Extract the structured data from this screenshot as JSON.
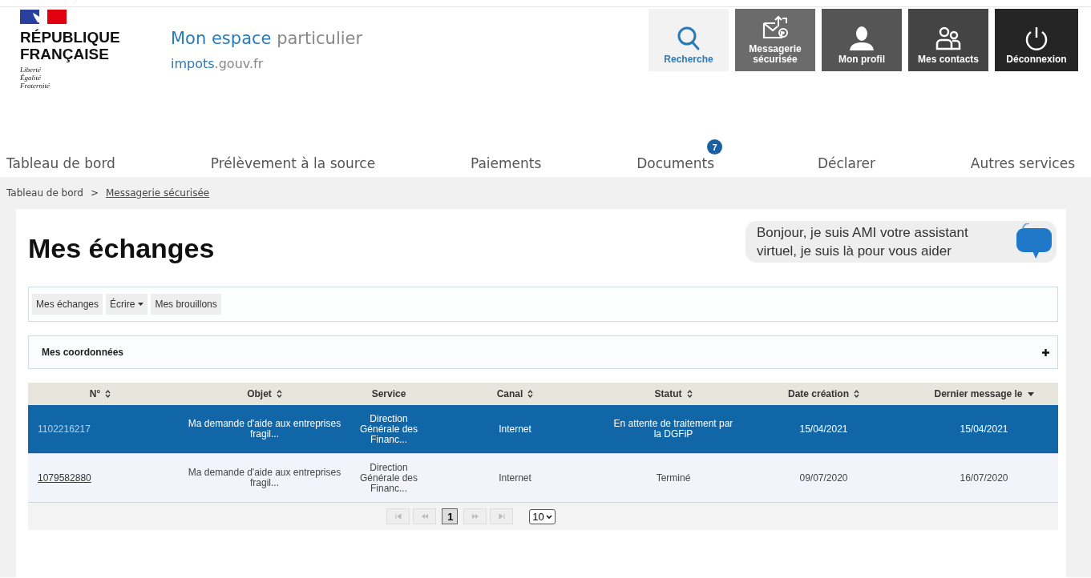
{
  "brand": {
    "republic": "RÉPUBLIQUE FRANÇAISE",
    "motto": [
      "Liberté",
      "Égalité",
      "Fraternité"
    ],
    "title": [
      {
        "text": "Mon espace",
        "kind": "accent"
      },
      {
        "text": " particulier",
        "kind": "plain"
      }
    ],
    "site": [
      {
        "text": "impots",
        "kind": "accent"
      },
      {
        "text": ".gouv.fr",
        "kind": "plain"
      }
    ]
  },
  "top_actions": [
    {
      "label": "Recherche",
      "kind": "search"
    },
    {
      "label": "Messagerie sécurisée",
      "kind": "messaging"
    },
    {
      "label": "Mon profil",
      "kind": "profile"
    },
    {
      "label": "Mes contacts",
      "kind": "contacts"
    },
    {
      "label": "Déconnexion",
      "kind": "logout"
    }
  ],
  "nav": [
    {
      "label": "Tableau de bord"
    },
    {
      "label": "Prélèvement à la source"
    },
    {
      "label": "Paiements"
    },
    {
      "label": "Documents",
      "badge": "7"
    },
    {
      "label": "Déclarer"
    },
    {
      "label": "Autres services"
    }
  ],
  "breadcrumb": {
    "items": [
      "Tableau de bord",
      "Messagerie sécurisée"
    ],
    "separator": ">"
  },
  "page_title": "Mes échanges",
  "assistant": {
    "message": "Bonjour, je suis AMI votre assistant virtuel, je suis là pour vous aider"
  },
  "toolbar": [
    {
      "label": "Mes échanges",
      "dropdown": false
    },
    {
      "label": "Écrire",
      "dropdown": true
    },
    {
      "label": "Mes brouillons",
      "dropdown": false
    }
  ],
  "accordion": {
    "title": "Mes coordonnées",
    "expanded": false
  },
  "table": {
    "columns": [
      {
        "label": "N°",
        "sortable": true,
        "sorted": false
      },
      {
        "label": "Objet",
        "sortable": true,
        "sorted": false
      },
      {
        "label": "Service",
        "sortable": false,
        "sorted": false
      },
      {
        "label": "Canal",
        "sortable": true,
        "sorted": false
      },
      {
        "label": "Statut",
        "sortable": true,
        "sorted": false
      },
      {
        "label": "Date création",
        "sortable": true,
        "sorted": false
      },
      {
        "label": "Dernier message le",
        "sortable": true,
        "sorted": true
      }
    ],
    "rows": [
      {
        "selected": true,
        "cells": [
          "1102216217",
          "Ma demande d'aide aux entreprises fragil...",
          "Direction Générale des Financ...",
          "Internet",
          "En attente de traitement par la DGFiP",
          "15/04/2021",
          "15/04/2021"
        ]
      },
      {
        "selected": false,
        "cells": [
          "1079582880",
          "Ma demande d'aide aux entreprises fragil...",
          "Direction Générale des Financ...",
          "Internet",
          "Terminé",
          "09/07/2020",
          "16/07/2020"
        ]
      }
    ]
  },
  "pagination": {
    "pages": [
      {
        "label": "1",
        "selected": true
      }
    ],
    "page_size": "10"
  }
}
